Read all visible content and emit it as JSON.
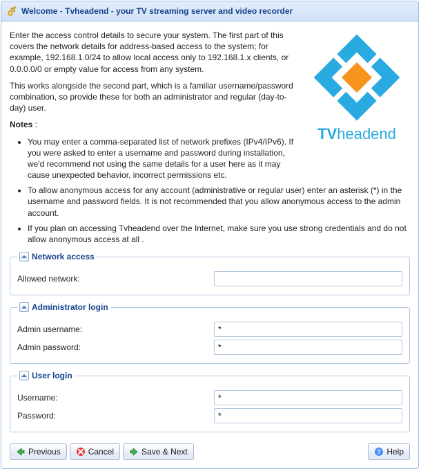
{
  "title": "Welcome - Tvheadend - your TV streaming server and video recorder",
  "logo_text_a": "TV",
  "logo_text_b": "headend",
  "intro": {
    "p1": "Enter the access control details to secure your system. The first part of this covers the network details for address-based access to the system; for example, 192.168.1.0/24 to allow local access only to 192.168.1.x clients, or 0.0.0.0/0 or empty value for access from any system.",
    "p2": "This works alongside the second part, which is a familiar username/password combination, so provide these for both an administrator and regular (day-to-day) user.",
    "notes_label": "Notes",
    "notes": [
      "You may enter a comma-separated list of network prefixes (IPv4/IPv6). If you were asked to enter a username and password during installation, we'd recommend not using the same details for a user here as it may cause unexpected behavior, incorrect permissions etc.",
      "To allow anonymous access for any account (administrative or regular user) enter an asterisk (*) in the username and password fields. It is not recommended that you allow anonymous access to the admin account.",
      "If you plan on accessing Tvheadend over the Internet, make sure you use strong credentials and do not allow anonymous access at all ."
    ]
  },
  "fieldsets": {
    "network": {
      "legend": "Network access",
      "allowed_network_label": "Allowed network:",
      "allowed_network_value": ""
    },
    "admin": {
      "legend": "Administrator login",
      "username_label": "Admin username:",
      "username_value": "*",
      "password_label": "Admin password:",
      "password_value": "*"
    },
    "user": {
      "legend": "User login",
      "username_label": "Username:",
      "username_value": "*",
      "password_label": "Password:",
      "password_value": "*"
    }
  },
  "buttons": {
    "previous": "Previous",
    "cancel": "Cancel",
    "save_next": "Save & Next",
    "help": "Help"
  }
}
